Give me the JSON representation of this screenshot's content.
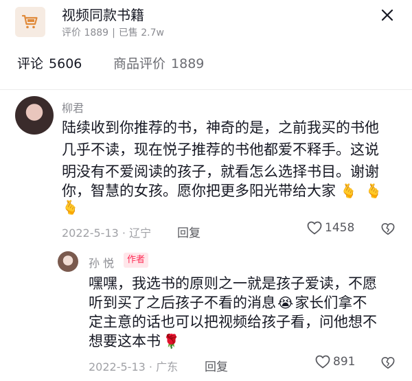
{
  "product": {
    "title": "视频同款书籍",
    "rating_label": "评价 1889",
    "separator": "|",
    "sold_label": "已售 2.7w",
    "icon": "cart-icon"
  },
  "tabs": [
    {
      "label": "评论",
      "count": "5606"
    },
    {
      "label": "商品评价",
      "count": "1889"
    }
  ],
  "comments": [
    {
      "username": "柳君",
      "lines": [
        "陆续收到你推荐的书，神奇的是，之前我买的书他",
        "几乎不读，现在悦子推荐的书他都爱不释手。这说",
        "明没有不爱阅读的孩子，就看怎么选择书目。谢谢",
        "你，智慧的女孩。愿你把更多阳光带给大家"
      ],
      "emojis": [
        "🫰",
        "🫰",
        "🫰"
      ],
      "date_location": "2022-5-13 · 辽宁",
      "reply_label": "回复",
      "likes": "1458",
      "reply": {
        "username": "孙 悦",
        "author_tag": "作者",
        "lines": [
          "嘿嘿，我选书的原则之一就是孩子爱读，不愿",
          "听到买了之后孩子不看的消息",
          "家长们拿不",
          "定主意的话也可以把视频给孩子看，问他想不",
          "想要这本书"
        ],
        "emojis": [
          "😭",
          "🌹"
        ],
        "date_location": "2022-5-13 · 广东",
        "reply_label": "回复",
        "likes": "891"
      }
    }
  ],
  "icons": {
    "close": "close-icon",
    "like": "heart-icon",
    "dislike": "broken-heart-icon"
  },
  "colors": {
    "author_tag": "#fe2c55",
    "author_tag_bg": "#ffe6ea",
    "text": "#161823",
    "secondary": "#8a8b91"
  }
}
